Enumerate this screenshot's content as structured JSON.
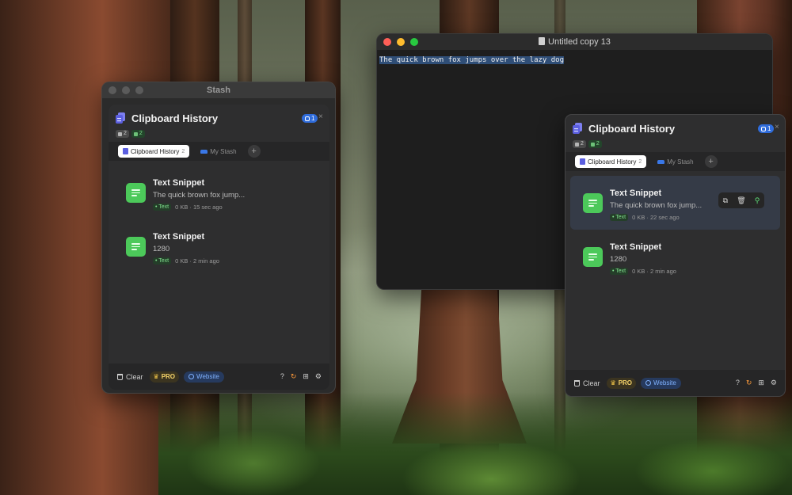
{
  "stash_window": {
    "title": "Stash",
    "panel": {
      "title": "Clipboard History",
      "pin_count": "1",
      "close": "×",
      "count_all": "2",
      "count_text": "2",
      "tabs": [
        {
          "label": "Clipboard History",
          "count": "2"
        },
        {
          "label": "My Stash"
        }
      ],
      "add_tab": "+",
      "items": [
        {
          "title": "Text Snippet",
          "preview": "The quick brown fox jump...",
          "type": "Text",
          "size": "0 KB",
          "time": "· 15 sec ago"
        },
        {
          "title": "Text Snippet",
          "preview": "1280",
          "type": "Text",
          "size": "0 KB",
          "time": "· 2 min ago"
        }
      ],
      "footer": {
        "clear": "Clear",
        "pro": "PRO",
        "website": "Website",
        "help": "?",
        "refresh": "↻",
        "add": "⊞",
        "settings": "⚙"
      }
    }
  },
  "text_window": {
    "title": "Untitled copy 13",
    "content": "The quick brown fox jumps over the lazy dog"
  },
  "float_panel": {
    "title": "Clipboard History",
    "pin_count": "1",
    "close": "×",
    "count_all": "2",
    "count_text": "2",
    "tabs": [
      {
        "label": "Clipboard History",
        "count": "2"
      },
      {
        "label": "My Stash"
      }
    ],
    "add_tab": "+",
    "items": [
      {
        "title": "Text Snippet",
        "preview": "The quick brown fox jump...",
        "type": "Text",
        "size": "0 KB",
        "time": "· 22 sec ago"
      },
      {
        "title": "Text Snippet",
        "preview": "1280",
        "type": "Text",
        "size": "0 KB",
        "time": "· 2 min ago"
      }
    ],
    "hover_actions": {
      "copy": "⧉",
      "delete": "🗑",
      "preview": "⚲"
    },
    "footer": {
      "clear": "Clear",
      "pro": "PRO",
      "website": "Website",
      "help": "?",
      "refresh": "↻",
      "add": "⊞",
      "settings": "⚙"
    }
  },
  "icons": {
    "logo": "clipboard-stack-icon",
    "snippet": "text-lines-icon",
    "crown": "crown-icon",
    "globe": "globe-icon"
  },
  "colors": {
    "accent_blue": "#2f6cdb",
    "snippet_green": "#4cc95a",
    "pro_gold": "#f5d36a",
    "refresh_orange": "#ff9b3a"
  }
}
